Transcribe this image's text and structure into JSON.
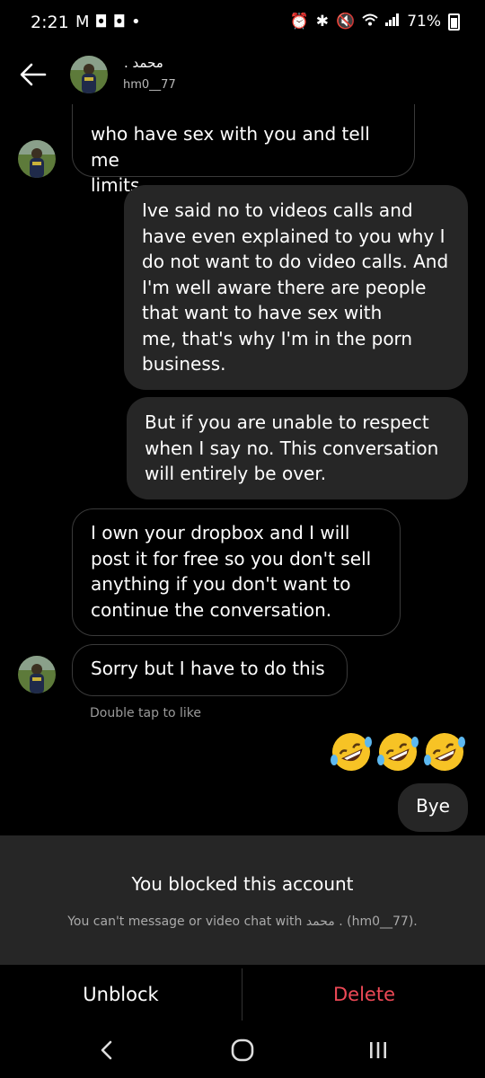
{
  "status_bar": {
    "time": "2:21",
    "left_icons": [
      "gmail-icon",
      "discord-icon",
      "discord-icon",
      "dot-icon"
    ],
    "battery": "71%"
  },
  "header": {
    "name": "محمد .",
    "username": "hm0__77"
  },
  "messages": [
    {
      "side": "in",
      "text": "who have sex with you and tell me\nlimits"
    },
    {
      "side": "out",
      "text": "Ive said no to videos calls and\nhave even explained to you why I\ndo not want to do video calls. And\nI'm well aware there are people\nthat want to have sex with\nme, that's why I'm in the porn\nbusiness."
    },
    {
      "side": "out",
      "text": "But if you are unable to respect\nwhen I say no. This conversation\nwill entirely be over."
    },
    {
      "side": "in",
      "text": "I own your dropbox and I will\npost it for free so you don't sell\nanything if you don't want to\ncontinue the conversation."
    },
    {
      "side": "in",
      "text": "Sorry but I have to do this"
    },
    {
      "side": "out",
      "text": "Bye"
    }
  ],
  "hint": "Double tap to like",
  "emoji_reply": [
    "rofl-emoji",
    "rofl-emoji",
    "rofl-emoji"
  ],
  "blocked": {
    "title": "You blocked this account",
    "subtitle": "You can't message or video chat with محمد . (hm0__77)."
  },
  "actions": {
    "unblock": "Unblock",
    "delete": "Delete"
  },
  "colors": {
    "background": "#000000",
    "incoming_border": "#3a3a3a",
    "outgoing_bubble": "#262626",
    "delete_red": "#ed4956"
  }
}
